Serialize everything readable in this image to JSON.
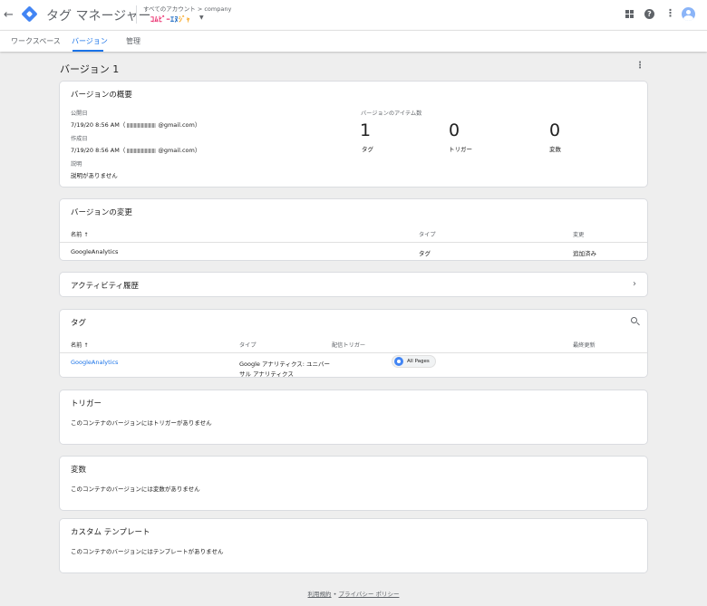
{
  "topbar": {
    "app_title": "タグ マネージャー",
    "breadcrumb": "すべてのアカウント > company",
    "container_name_parts": [
      "ｺﾑﾋﾞｰ",
      "ｴﾇ",
      "ｼﾞｬ"
    ]
  },
  "tabs": [
    {
      "label": "ワークスペース",
      "active": false
    },
    {
      "label": "バージョン",
      "active": true
    },
    {
      "label": "管理",
      "active": false
    }
  ],
  "page": {
    "title": "バージョン 1"
  },
  "overview": {
    "title": "バージョンの概要",
    "published_label": "公開日",
    "published_value": "7/19/20 8:56 AM（",
    "published_email": "@gmail.com）",
    "created_label": "作成日",
    "created_value": "7/19/20 8:56 AM（",
    "created_email": "@gmail.com）",
    "description_label": "説明",
    "description_value": "説明がありません",
    "items_label": "バージョンのアイテム数",
    "counts": [
      {
        "value": "1",
        "label": "タグ"
      },
      {
        "value": "0",
        "label": "トリガー"
      },
      {
        "value": "0",
        "label": "変数"
      }
    ]
  },
  "changes": {
    "title": "バージョンの変更",
    "headers": [
      "名前 ↑",
      "タイプ",
      "変更"
    ],
    "rows": [
      {
        "name": "GoogleAnalytics",
        "type": "タグ",
        "change": "追加済み"
      }
    ]
  },
  "activity": {
    "title": "アクティビティ履歴"
  },
  "tags": {
    "title": "タグ",
    "headers": [
      "名前 ↑",
      "タイプ",
      "配信トリガー",
      "最終更新"
    ],
    "rows": [
      {
        "name": "GoogleAnalytics",
        "type_line1": "Google アナリティクス: ユニバー",
        "type_line2": "サル アナリティクス",
        "trigger": "All Pages"
      }
    ]
  },
  "triggers": {
    "title": "トリガー",
    "empty": "このコンテナのバージョンにはトリガーがありません"
  },
  "variables": {
    "title": "変数",
    "empty": "このコンテナのバージョンには変数がありません"
  },
  "templates": {
    "title": "カスタム テンプレート",
    "empty": "このコンテナのバージョンにはテンプレートがありません"
  },
  "footer": {
    "terms": "利用規約",
    "separator": " • ",
    "privacy": "プライバシー ポリシー"
  },
  "colors": {
    "accent": "#1a73e8",
    "background": "#eeeeee"
  }
}
